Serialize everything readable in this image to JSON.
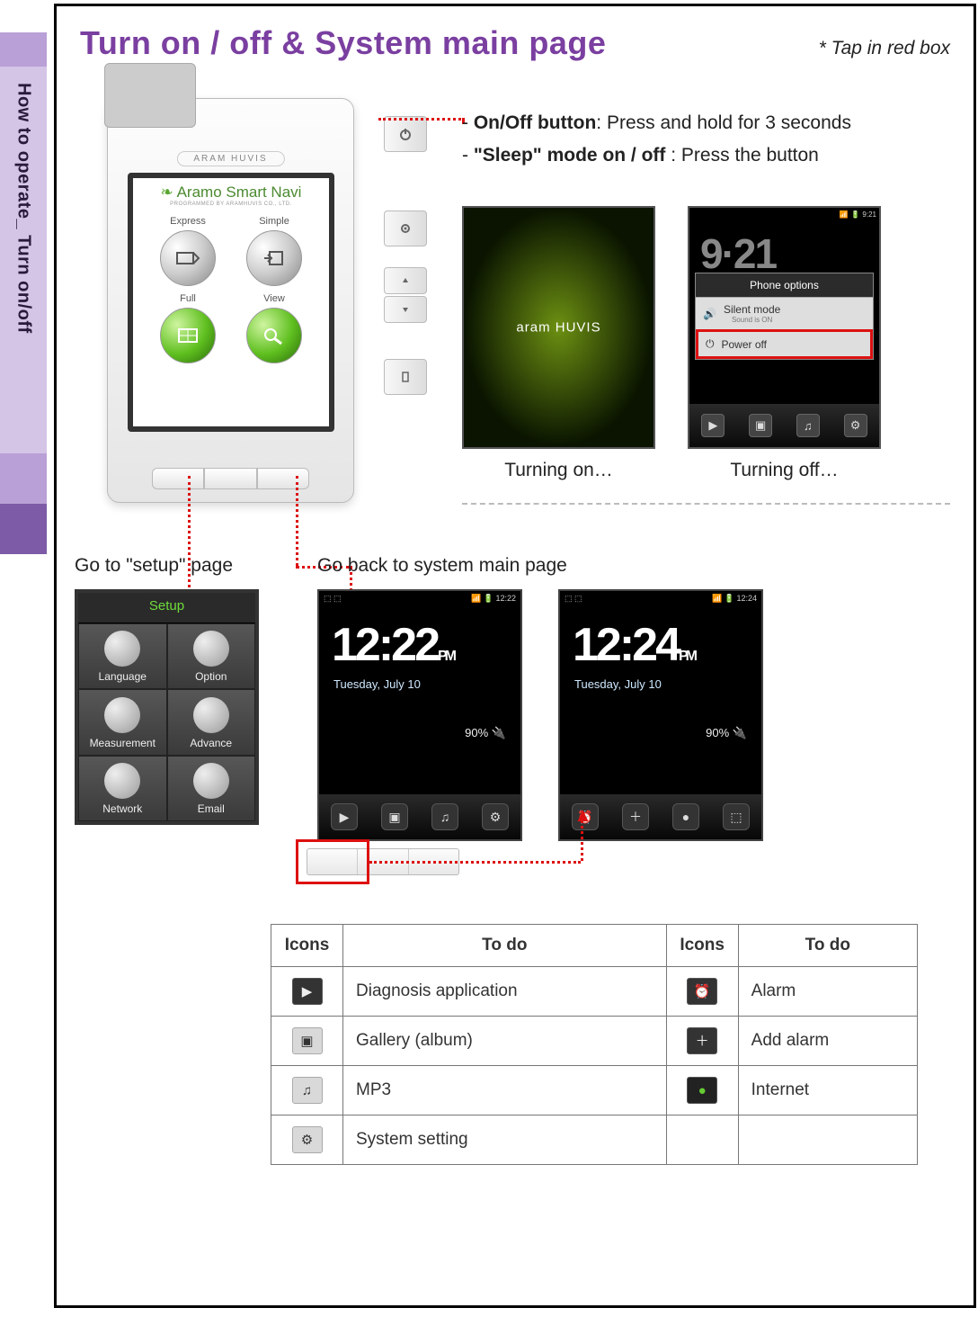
{
  "sidebar": {
    "title": "How to operate_ Turn on/off"
  },
  "title": "Turn on / off & System main page",
  "note": "* Tap in red box",
  "instructions": {
    "line1_dash": "- ",
    "line1_bold": "On/Off button",
    "line1_rest": ": Press and hold for 3 seconds",
    "line2_dash": "- ",
    "line2_bold": "\"Sleep\" mode on / off",
    "line2_rest": " : Press the button"
  },
  "device": {
    "brand": "ARAM HUVIS",
    "screen_title": "Aramo Smart Navi",
    "screen_sub": "PROGRAMMED BY ARAMHUVIS CO., LTD.",
    "apps": {
      "express": "Express",
      "simple": "Simple",
      "full": "Full",
      "view": "View"
    }
  },
  "turning_on": {
    "caption": "Turning on…",
    "logo": "aram HUVIS"
  },
  "turning_off": {
    "caption": "Turning off…",
    "status_time": "9:21",
    "time_big": "9·21",
    "popup_title": "Phone options",
    "silent": "Silent mode",
    "silent_sub": "Sound is ON",
    "poweroff": "Power off"
  },
  "setup": {
    "label": "Go to \"setup\" page",
    "header": "Setup",
    "cells": [
      "Language",
      "Option",
      "Measurement",
      "Advance",
      "Network",
      "Email"
    ]
  },
  "goback_label": "Go back to system main page",
  "sys": {
    "time_left": "12:22",
    "time_right": "12:24",
    "status_left": "12:22",
    "status_right": "12:24",
    "pm": "PM",
    "date": "Tuesday, July 10",
    "battery": "90%"
  },
  "table": {
    "h_icons": "Icons",
    "h_todo": "To do",
    "rows": [
      [
        "Diagnosis application",
        "Alarm"
      ],
      [
        "Gallery (album)",
        "Add alarm"
      ],
      [
        "MP3",
        "Internet"
      ],
      [
        "System setting",
        ""
      ]
    ]
  }
}
